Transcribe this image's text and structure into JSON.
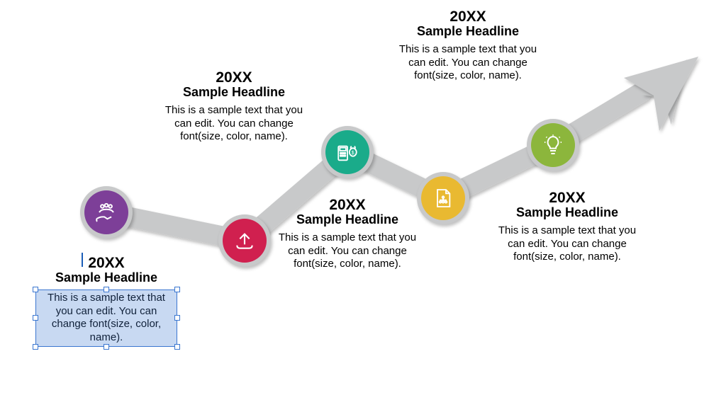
{
  "milestones": [
    {
      "id": "m1",
      "year": "20XX",
      "headline": "Sample Headline",
      "desc": "This is a sample text that you can edit. You can change font(size, color, name).",
      "color": "#7d3f98",
      "icon": "people-hand-icon",
      "textPosition": "below",
      "selected": true
    },
    {
      "id": "m2",
      "year": "20XX",
      "headline": "Sample Headline",
      "desc": "This is a sample text that you can edit. You can change font(size, color, name).",
      "color": "#d0204f",
      "icon": "upload-icon",
      "textPosition": "above"
    },
    {
      "id": "m3",
      "year": "20XX",
      "headline": "Sample Headline",
      "desc": "This is a sample text that you can edit. You can change font(size, color, name).",
      "color": "#1aab8a",
      "icon": "calculator-money-icon",
      "textPosition": "below-alt"
    },
    {
      "id": "m4",
      "year": "20XX",
      "headline": "Sample Headline",
      "desc": "This is a sample text that you can edit. You can change font(size, color, name).",
      "color": "#e9b931",
      "icon": "document-chart-icon",
      "textPosition": "above-alt"
    },
    {
      "id": "m5",
      "year": "20XX",
      "headline": "Sample Headline",
      "desc": "This is a sample text that you can edit. You can change font(size, color, name).",
      "color": "#8cb63c",
      "icon": "lightbulb-icon",
      "textPosition": "right"
    }
  ]
}
